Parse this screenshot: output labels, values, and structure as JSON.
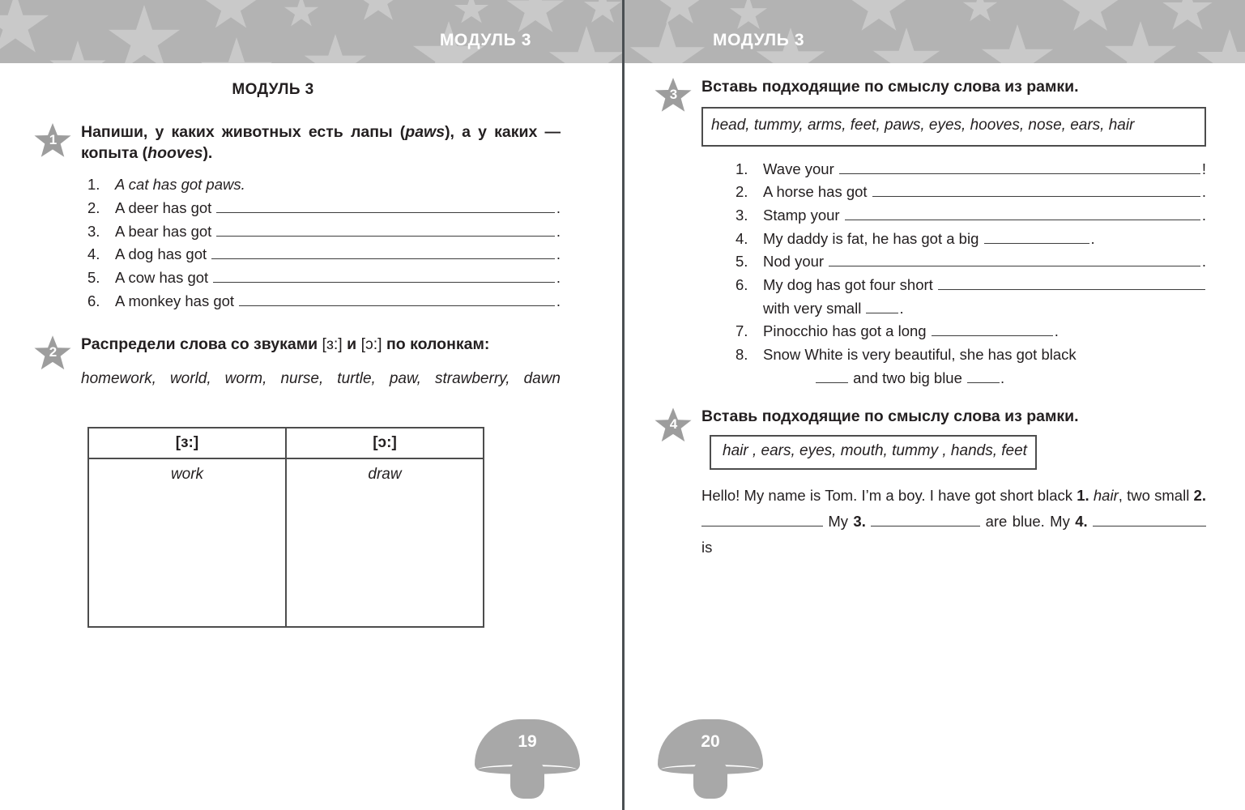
{
  "meta": {
    "colors": {
      "band": "#b3b3b3",
      "band_star": "#c9c9c9",
      "gutter": "#4a4f52",
      "badge": "#9d9d9d",
      "ink": "#231f20",
      "rule": "#3d3d3d",
      "folio": "#a8a8a8"
    }
  },
  "header": {
    "left_title": "МОДУЛЬ 3",
    "right_title": "МОДУЛЬ 3"
  },
  "left_page": {
    "module_title": "МОДУЛЬ 3",
    "folio": "19",
    "exercise1": {
      "number": "1",
      "prompt_parts": {
        "a": "Напиши, у каких животных есть лапы (",
        "b": "paws",
        "c": "), а у каких — копыта (",
        "d": "hooves",
        "e": ")."
      },
      "items": [
        {
          "n": "1.",
          "text": "A cat has got paws.",
          "italic": true,
          "blank": false,
          "tail": ""
        },
        {
          "n": "2.",
          "text": "A deer has got ",
          "italic": false,
          "blank": true,
          "tail": "."
        },
        {
          "n": "3.",
          "text": "A bear has got ",
          "italic": false,
          "blank": true,
          "tail": "."
        },
        {
          "n": "4.",
          "text": "A dog has got ",
          "italic": false,
          "blank": true,
          "tail": "."
        },
        {
          "n": "5.",
          "text": "A cow has got ",
          "italic": false,
          "blank": true,
          "tail": "."
        },
        {
          "n": "6.",
          "text": "A monkey has got ",
          "italic": false,
          "blank": true,
          "tail": "."
        }
      ]
    },
    "exercise2": {
      "number": "2",
      "prompt_parts": {
        "a": "Распредели слова со звуками ",
        "ipa1": "[ɜ:]",
        "b": " и ",
        "ipa2": "[ɔ:]",
        "c": " по колонкам:"
      },
      "words": "homework, world, worm, nurse, turtle, paw, strawberry, dawn",
      "table": {
        "headers": [
          "[ɜ:]",
          "[ɔ:]"
        ],
        "rows": [
          [
            "work",
            "draw"
          ]
        ]
      }
    }
  },
  "right_page": {
    "folio": "20",
    "exercise3": {
      "number": "3",
      "prompt": "Вставь подходящие по смыслу слова из рамки.",
      "word_box": "head, tummy, arms, feet, paws, eyes, hooves, nose, ears, hair",
      "items": [
        {
          "n": "1.",
          "text": "Wave your ",
          "blank": "flex",
          "tail": "!"
        },
        {
          "n": "2.",
          "text": "A horse has got ",
          "blank": "flex",
          "tail": "."
        },
        {
          "n": "3.",
          "text": "Stamp your ",
          "blank": "flex",
          "tail": "."
        },
        {
          "n": "4.",
          "text": "My daddy is fat, he has got a big ",
          "blank": "fixed-130",
          "tail": "."
        },
        {
          "n": "5.",
          "text": "Nod your ",
          "blank": "flex",
          "tail": "."
        }
      ],
      "item6": {
        "n": "6.",
        "line1_text": "My dog has got four short ",
        "line1_tail": "",
        "line2_text": "with very small ",
        "line2_tail": "."
      },
      "item7": {
        "n": "7.",
        "text": "Pinocchio has got a long ",
        "tail": "."
      },
      "item8": {
        "n": "8.",
        "line1": "Snow White is very beautiful, she has got black",
        "line2_mid": " and two big blue ",
        "line2_tail": "."
      }
    },
    "exercise4": {
      "number": "4",
      "prompt": "Вставь подходящие по смыслу слова из рамки.",
      "word_box": "hair , ears, eyes, mouth, tummy , hands, feet",
      "paragraph": {
        "p1": "Hello! My name is Tom. I’m a boy. I have got short black ",
        "b1": "1.",
        "fill1": "hair",
        "p2": ", two small ",
        "b2": "2.",
        "p3": " My ",
        "b3": "3.",
        "p4": " are blue. My ",
        "b4": "4.",
        "p5": "is"
      }
    }
  }
}
